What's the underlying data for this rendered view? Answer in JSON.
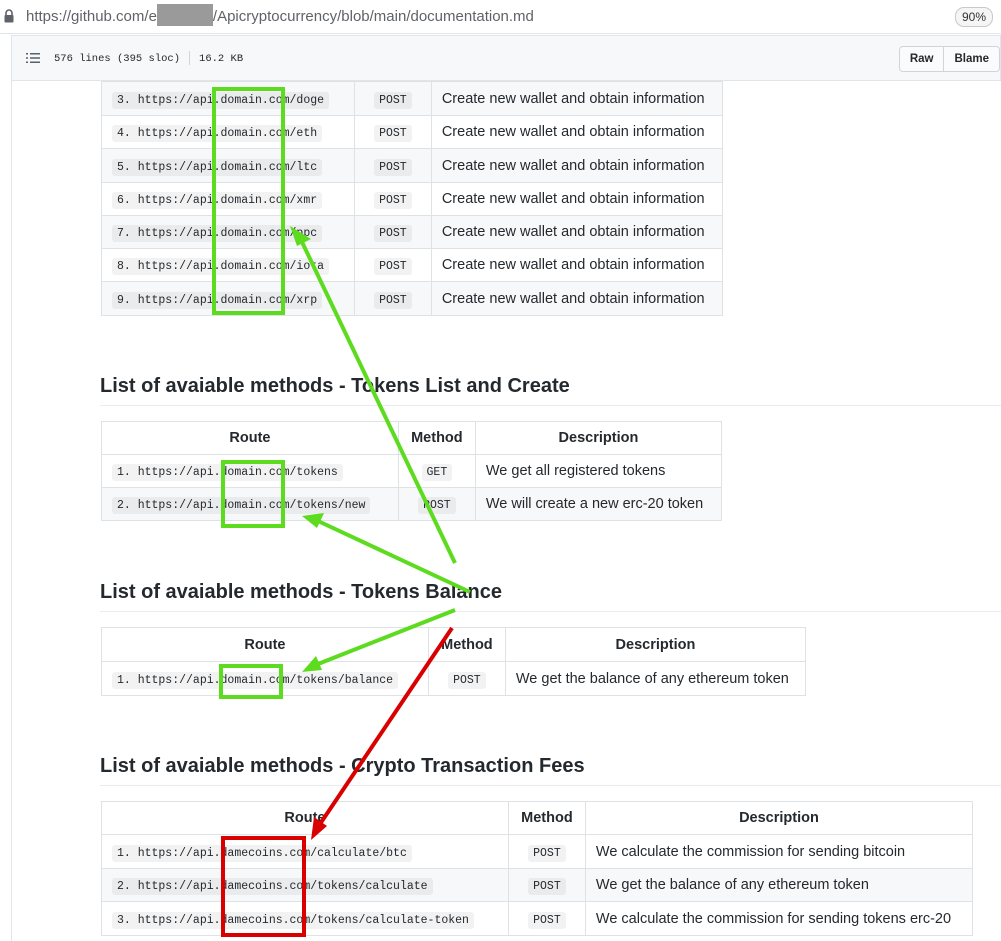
{
  "browser": {
    "url_prefix": "https://github.com/e",
    "url_suffix": "/Apicryptocurrency/blob/main/documentation.md",
    "zoom": "90%"
  },
  "file_header": {
    "lines": "576 lines (395 sloc)",
    "size": "16.2 KB",
    "raw_label": "Raw",
    "blame_label": "Blame"
  },
  "wallet_table": {
    "rows": [
      {
        "route": "3. https://api.domain.com/doge",
        "method": "POST",
        "description": "Create new wallet and obtain information"
      },
      {
        "route": "4. https://api.domain.com/eth",
        "method": "POST",
        "description": "Create new wallet and obtain information"
      },
      {
        "route": "5. https://api.domain.com/ltc",
        "method": "POST",
        "description": "Create new wallet and obtain information"
      },
      {
        "route": "6. https://api.domain.com/xmr",
        "method": "POST",
        "description": "Create new wallet and obtain information"
      },
      {
        "route": "7. https://api.domain.com/ppc",
        "method": "POST",
        "description": "Create new wallet and obtain information"
      },
      {
        "route": "8. https://api.domain.com/iota",
        "method": "POST",
        "description": "Create new wallet and obtain information"
      },
      {
        "route": "9. https://api.domain.com/xrp",
        "method": "POST",
        "description": "Create new wallet and obtain information"
      }
    ]
  },
  "sections": [
    {
      "title": "List of avaiable methods - Tokens List and Create",
      "headers": [
        "Route",
        "Method",
        "Description"
      ],
      "rows": [
        {
          "route": "1. https://api.domain.com/tokens",
          "method": "GET",
          "description": "We get all registered tokens"
        },
        {
          "route": "2. https://api.domain.com/tokens/new",
          "method": "POST",
          "description": "We will create a new erc-20 token"
        }
      ]
    },
    {
      "title": "List of avaiable methods - Tokens Balance",
      "headers": [
        "Route",
        "Method",
        "Description"
      ],
      "rows": [
        {
          "route": "1. https://api.domain.com/tokens/balance",
          "method": "POST",
          "description": "We get the balance of any ethereum token"
        }
      ]
    },
    {
      "title": "List of avaiable methods - Crypto Transaction Fees",
      "headers": [
        "Route",
        "Method",
        "Description"
      ],
      "rows": [
        {
          "route": "1. https://api.damecoins.com/calculate/btc",
          "method": "POST",
          "description": "We calculate the commission for sending bitcoin"
        },
        {
          "route": "2. https://api.damecoins.com/tokens/calculate",
          "method": "POST",
          "description": "We get the balance of any ethereum token"
        },
        {
          "route": "3. https://api.damecoins.com/tokens/calculate-token",
          "method": "POST",
          "description": "We calculate the commission for sending tokens erc-20"
        }
      ]
    }
  ],
  "annotations": {
    "green_color": "#5cdb1f",
    "red_color": "#d90000"
  }
}
